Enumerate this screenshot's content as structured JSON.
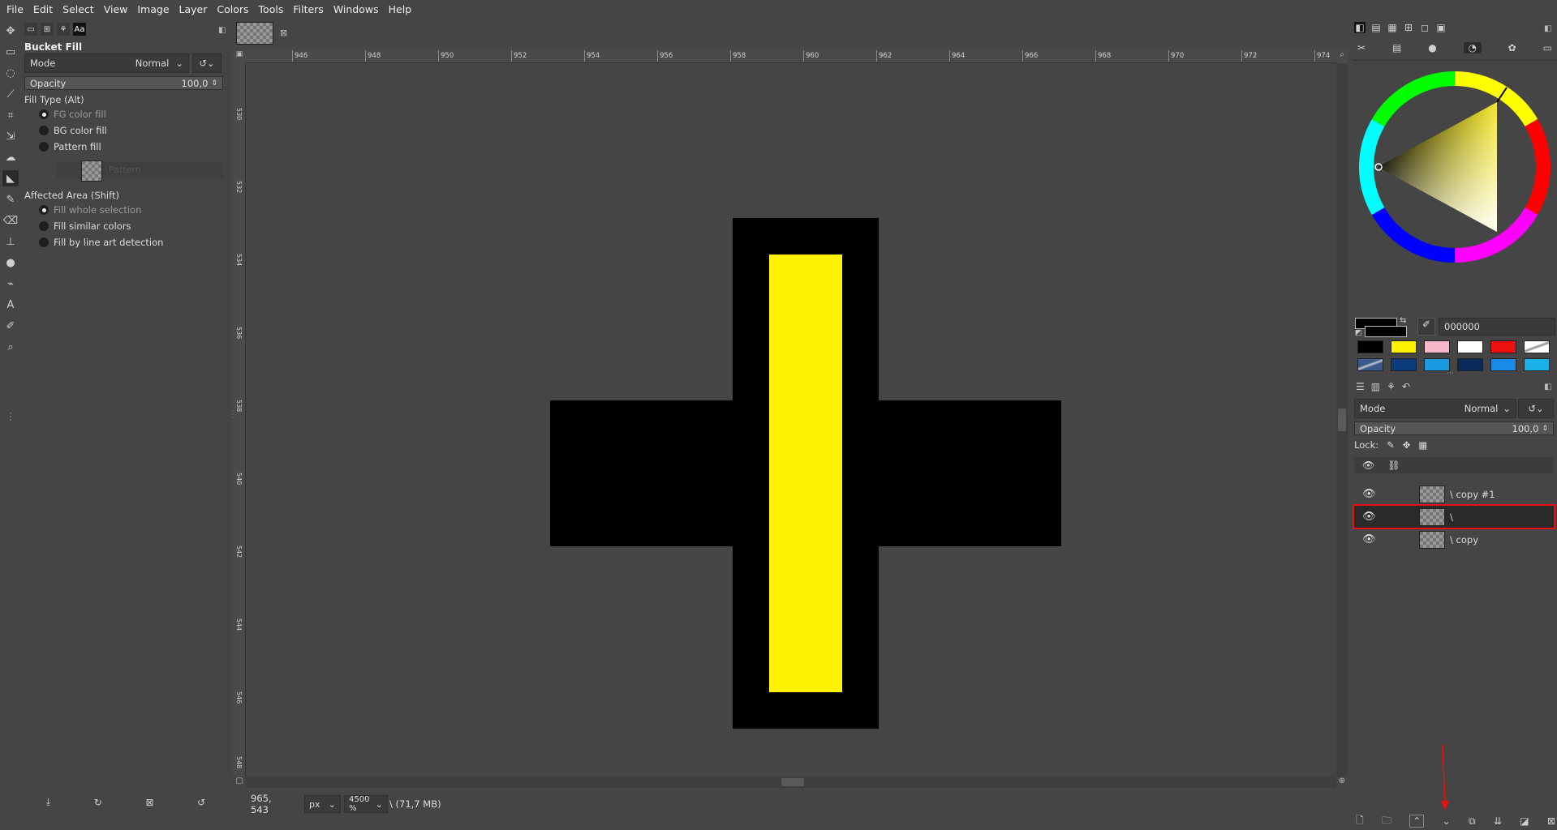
{
  "menubar": [
    "File",
    "Edit",
    "Select",
    "View",
    "Image",
    "Layer",
    "Colors",
    "Tools",
    "Filters",
    "Windows",
    "Help"
  ],
  "tool_options": {
    "title": "Bucket Fill",
    "mode_label": "Mode",
    "mode_value": "Normal",
    "opacity_label": "Opacity",
    "opacity_value": "100,0",
    "fill_type_label": "Fill Type  (Alt)",
    "fill_fg": "FG color fill",
    "fill_bg": "BG color fill",
    "fill_pattern": "Pattern fill",
    "pattern_name": "Pattern",
    "affected_label": "Affected Area  (Shift)",
    "area_whole": "Fill whole selection",
    "area_similar": "Fill similar colors",
    "area_lineart": "Fill by line art detection"
  },
  "ruler": {
    "h_ticks": [
      "946",
      "948",
      "950",
      "952",
      "954",
      "956",
      "958",
      "960",
      "962",
      "964",
      "966",
      "968",
      "970",
      "972",
      "974"
    ],
    "v_ticks": [
      "530",
      "532",
      "534",
      "536",
      "538",
      "540",
      "542",
      "544",
      "546",
      "548"
    ]
  },
  "status": {
    "coords": "965, 543",
    "unit": "px",
    "zoom": "4500 %",
    "memory": "\\ (71,7 MB)"
  },
  "colors": {
    "hex_value": "000000",
    "fg": "#000000",
    "bg": "#000000",
    "swatches": [
      "#000000",
      "#fff200",
      "#f4b8c8",
      "#ffffff",
      "#ee1111",
      "#cccccc",
      "#3a5a8a",
      "#0a3a7a",
      "#1a9ae0",
      "#0b2a5a",
      "#1a8ae8",
      "#1ab0e8"
    ]
  },
  "layers": {
    "mode_label": "Mode",
    "mode_value": "Normal",
    "opacity_label": "Opacity",
    "opacity_value": "100,0",
    "lock_label": "Lock:",
    "items": [
      {
        "name": "\\ copy #1"
      },
      {
        "name": "\\"
      },
      {
        "name": "\\ copy"
      }
    ]
  },
  "accent": {
    "selection_outline": "#e81010",
    "arrow": "#e81010",
    "fill_yellow": "#fff200"
  }
}
